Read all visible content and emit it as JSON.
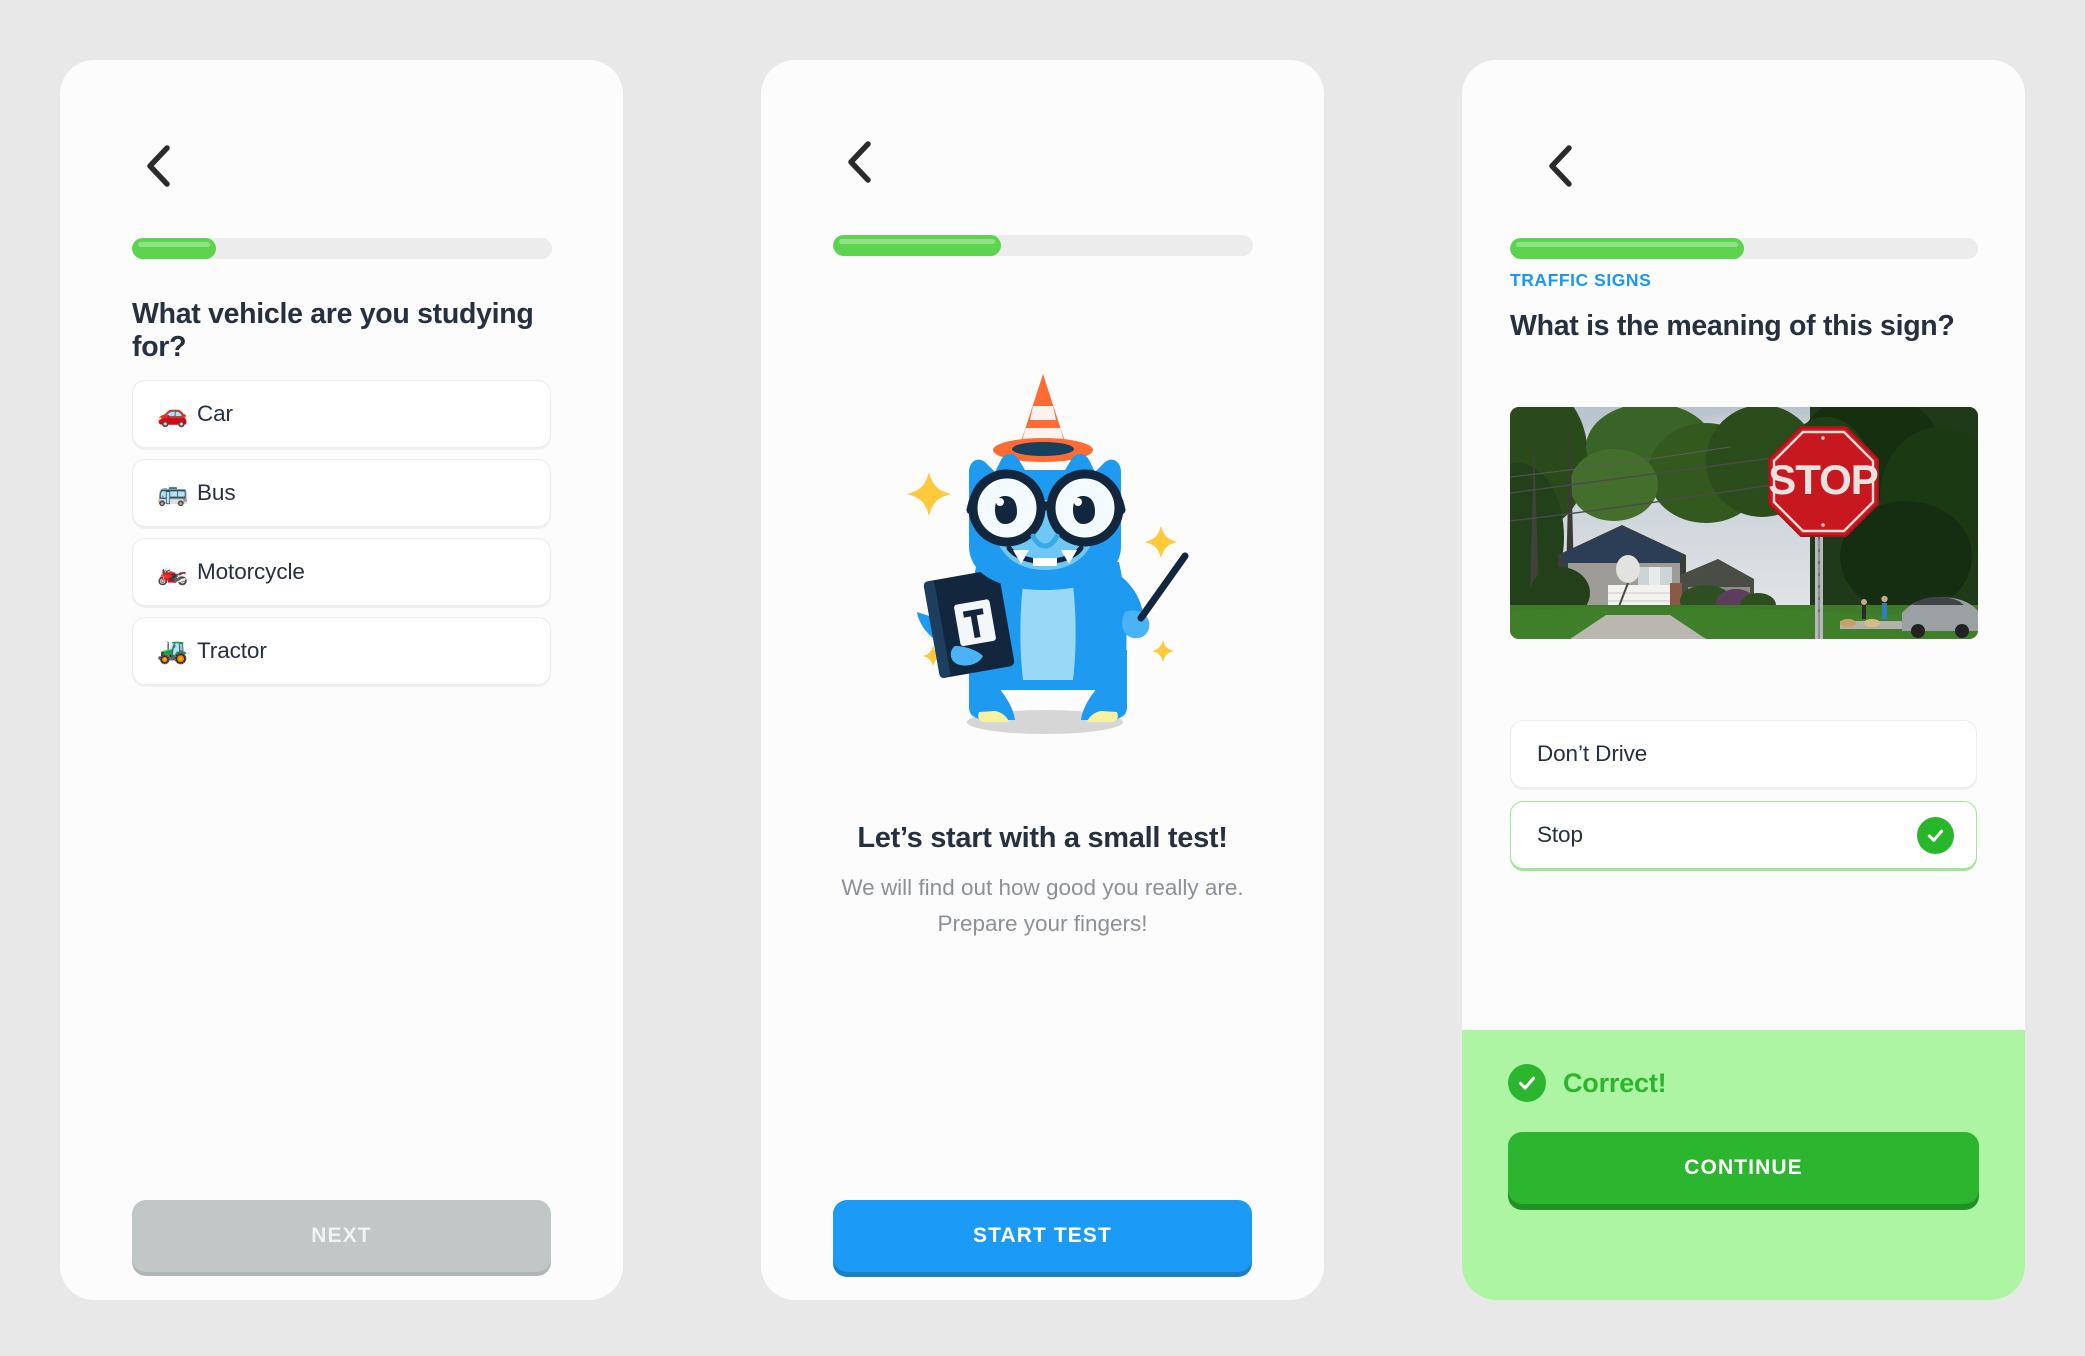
{
  "theme": {
    "page_bg": "#e8e8e8",
    "card_bg": "#fcfcfc",
    "accent_blue": "#1b9bf5",
    "accent_green": "#5dd44f",
    "correct_green": "#2cb52f",
    "banner_green": "#adf5a2",
    "text_dark": "#27303f",
    "text_muted": "#8c9196",
    "disabled_grey": "#c1c6c7"
  },
  "screen_vehicle": {
    "back_icon": "chevron-left-icon",
    "progress_percent": 20,
    "question": "What vehicle are you studying for?",
    "options": [
      {
        "emoji": "🚗",
        "icon_name": "car-emoji",
        "label": "Car"
      },
      {
        "emoji": "🚌",
        "icon_name": "bus-emoji",
        "label": "Bus"
      },
      {
        "emoji": "🏍️",
        "icon_name": "motorcycle-emoji",
        "label": "Motorcycle"
      },
      {
        "emoji": "🚜",
        "icon_name": "tractor-emoji",
        "label": "Tractor"
      }
    ],
    "next_label": "NEXT",
    "next_enabled": false
  },
  "screen_start": {
    "back_icon": "chevron-left-icon",
    "progress_percent": 40,
    "mascot": "dinosaur-teacher-mascot",
    "headline": "Let’s start with a small test!",
    "subline": "We will find out how good you really are. Prepare your fingers!",
    "start_label": "START TEST"
  },
  "screen_question": {
    "back_icon": "chevron-left-icon",
    "progress_percent": 50,
    "category": "TRAFFIC SIGNS",
    "question": "What is the meaning of this sign?",
    "photo_alt": "Suburban street with a red octagonal STOP sign on a pole, house and trees behind",
    "photo_sign_text": "STOP",
    "answers": [
      {
        "label": "Don’t Drive",
        "state": "default",
        "tick_icon": null
      },
      {
        "label": "Stop",
        "state": "correct",
        "tick_icon": "check-circle-icon"
      }
    ],
    "feedback": {
      "icon": "check-circle-icon",
      "text": "Correct!"
    },
    "continue_label": "CONTINUE"
  }
}
